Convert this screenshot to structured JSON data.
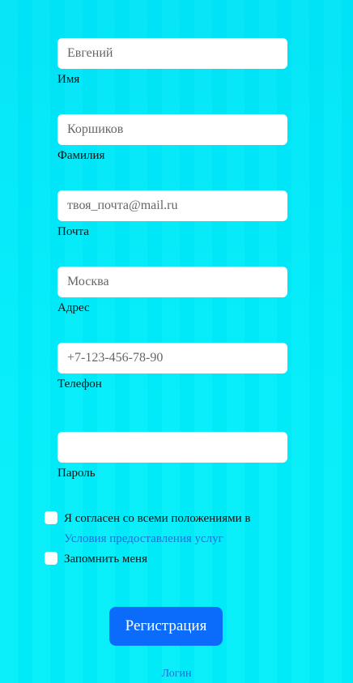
{
  "form": {
    "fields": [
      {
        "value": "",
        "placeholder": "Евгений",
        "label": "Имя"
      },
      {
        "value": "",
        "placeholder": "Коршиков",
        "label": "Фамилия"
      },
      {
        "value": "",
        "placeholder": "твоя_почта@mail.ru",
        "label": "Почта"
      },
      {
        "value": "",
        "placeholder": "Москва",
        "label": "Адрес"
      },
      {
        "value": "",
        "placeholder": "+7-123-456-78-90",
        "label": "Телефон"
      },
      {
        "value": "",
        "placeholder": "",
        "label": "Пароль"
      }
    ],
    "agree": {
      "text": "Я согласен со всеми положениями в",
      "link": "Условия предоставления услуг"
    },
    "remember": {
      "text": "Запомнить меня"
    },
    "submit_label": "Регистрация",
    "login_link": "Логин"
  }
}
